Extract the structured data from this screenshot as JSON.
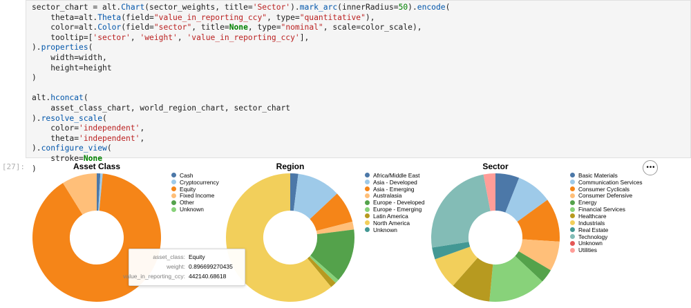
{
  "code_cell": {
    "lines": [
      [
        {
          "t": "sector_chart = alt.",
          "c": ""
        },
        {
          "t": "Chart",
          "c": "attr"
        },
        {
          "t": "(sector_weights, title=",
          "c": ""
        },
        {
          "t": "'Sector'",
          "c": "str"
        },
        {
          "t": ").",
          "c": ""
        },
        {
          "t": "mark_arc",
          "c": "attr"
        },
        {
          "t": "(innerRadius=",
          "c": ""
        },
        {
          "t": "50",
          "c": "num"
        },
        {
          "t": ").",
          "c": ""
        },
        {
          "t": "encode",
          "c": "attr"
        },
        {
          "t": "(",
          "c": ""
        }
      ],
      [
        {
          "t": "    theta=alt.",
          "c": ""
        },
        {
          "t": "Theta",
          "c": "attr"
        },
        {
          "t": "(field=",
          "c": ""
        },
        {
          "t": "\"value_in_reporting_ccy\"",
          "c": "str"
        },
        {
          "t": ", type=",
          "c": ""
        },
        {
          "t": "\"quantitative\"",
          "c": "str"
        },
        {
          "t": "),",
          "c": ""
        }
      ],
      [
        {
          "t": "    color=alt.",
          "c": ""
        },
        {
          "t": "Color",
          "c": "attr"
        },
        {
          "t": "(field=",
          "c": ""
        },
        {
          "t": "\"sector\"",
          "c": "str"
        },
        {
          "t": ", title=",
          "c": ""
        },
        {
          "t": "None",
          "c": "kw"
        },
        {
          "t": ", type=",
          "c": ""
        },
        {
          "t": "\"nominal\"",
          "c": "str"
        },
        {
          "t": ", scale=color_scale),",
          "c": ""
        }
      ],
      [
        {
          "t": "    tooltip=[",
          "c": ""
        },
        {
          "t": "'sector'",
          "c": "str"
        },
        {
          "t": ", ",
          "c": ""
        },
        {
          "t": "'weight'",
          "c": "str"
        },
        {
          "t": ", ",
          "c": ""
        },
        {
          "t": "'value_in_reporting_ccy'",
          "c": "str"
        },
        {
          "t": "],",
          "c": ""
        }
      ],
      [
        {
          "t": ").",
          "c": ""
        },
        {
          "t": "properties",
          "c": "attr"
        },
        {
          "t": "(",
          "c": ""
        }
      ],
      [
        {
          "t": "    width=width,",
          "c": ""
        }
      ],
      [
        {
          "t": "    height=height",
          "c": ""
        }
      ],
      [
        {
          "t": ")",
          "c": ""
        }
      ],
      [
        {
          "t": "",
          "c": ""
        }
      ],
      [
        {
          "t": "alt.",
          "c": ""
        },
        {
          "t": "hconcat",
          "c": "attr"
        },
        {
          "t": "(",
          "c": ""
        }
      ],
      [
        {
          "t": "    asset_class_chart, world_region_chart, sector_chart",
          "c": ""
        }
      ],
      [
        {
          "t": ").",
          "c": ""
        },
        {
          "t": "resolve_scale",
          "c": "attr"
        },
        {
          "t": "(",
          "c": ""
        }
      ],
      [
        {
          "t": "    color=",
          "c": ""
        },
        {
          "t": "'independent'",
          "c": "str"
        },
        {
          "t": ",",
          "c": ""
        }
      ],
      [
        {
          "t": "    theta=",
          "c": ""
        },
        {
          "t": "'independent'",
          "c": "str"
        },
        {
          "t": ",",
          "c": ""
        }
      ],
      [
        {
          "t": ").",
          "c": ""
        },
        {
          "t": "configure_view",
          "c": "attr"
        },
        {
          "t": "(",
          "c": ""
        }
      ],
      [
        {
          "t": "    stroke=",
          "c": ""
        },
        {
          "t": "None",
          "c": "kw"
        }
      ],
      [
        {
          "t": ")",
          "c": ""
        }
      ]
    ]
  },
  "output_prompt": "[27]:",
  "actions_button_label": "•••",
  "tooltip": {
    "rows": [
      {
        "key": "asset_class:",
        "value": "Equity"
      },
      {
        "key": "weight:",
        "value": "0.896699270435"
      },
      {
        "key": "value_in_reporting_ccy:",
        "value": "442140.68618"
      }
    ]
  },
  "chart_data": [
    {
      "type": "pie",
      "title": "Asset Class",
      "legend_position": "right",
      "inner_radius_ratio": 0.42,
      "categories": [
        "Cash",
        "Cryptocurrency",
        "Equity",
        "Fixed Income",
        "Other",
        "Unknown"
      ],
      "colors": [
        "#4c78a8",
        "#9ecae9",
        "#f58518",
        "#ffbf79",
        "#54a24b",
        "#88d27a"
      ],
      "values": [
        0.009,
        0.006,
        0.8967,
        0.0883,
        0,
        0
      ]
    },
    {
      "type": "pie",
      "title": "Region",
      "legend_position": "right",
      "inner_radius_ratio": 0.42,
      "categories": [
        "Africa/Middle East",
        "Asia - Developed",
        "Asia - Emerging",
        "Australasia",
        "Europe - Developed",
        "Europe - Emerging",
        "Latin America",
        "North America",
        "Unknown"
      ],
      "colors": [
        "#4c78a8",
        "#9ecae9",
        "#f58518",
        "#ffbf79",
        "#54a24b",
        "#88d27a",
        "#b79a20",
        "#f2cf5b",
        "#439894"
      ],
      "values": [
        0.02,
        0.11,
        0.08,
        0.02,
        0.135,
        0.01,
        0.015,
        0.61,
        0
      ]
    },
    {
      "type": "pie",
      "title": "Sector",
      "legend_position": "right",
      "inner_radius_ratio": 0.42,
      "categories": [
        "Basic Materials",
        "Communication Services",
        "Consumer Cyclicals",
        "Consumer Defensive",
        "Energy",
        "Financial Services",
        "Healthcare",
        "Industrials",
        "Real Estate",
        "Technology",
        "Unknown",
        "Utilities"
      ],
      "colors": [
        "#4c78a8",
        "#9ecae9",
        "#f58518",
        "#ffbf79",
        "#54a24b",
        "#88d27a",
        "#b79a20",
        "#f2cf5b",
        "#439894",
        "#83bcb6",
        "#e45756",
        "#ff9d98"
      ],
      "values": [
        0.06,
        0.09,
        0.11,
        0.075,
        0.035,
        0.145,
        0.1,
        0.08,
        0.03,
        0.245,
        0,
        0.03
      ]
    }
  ]
}
